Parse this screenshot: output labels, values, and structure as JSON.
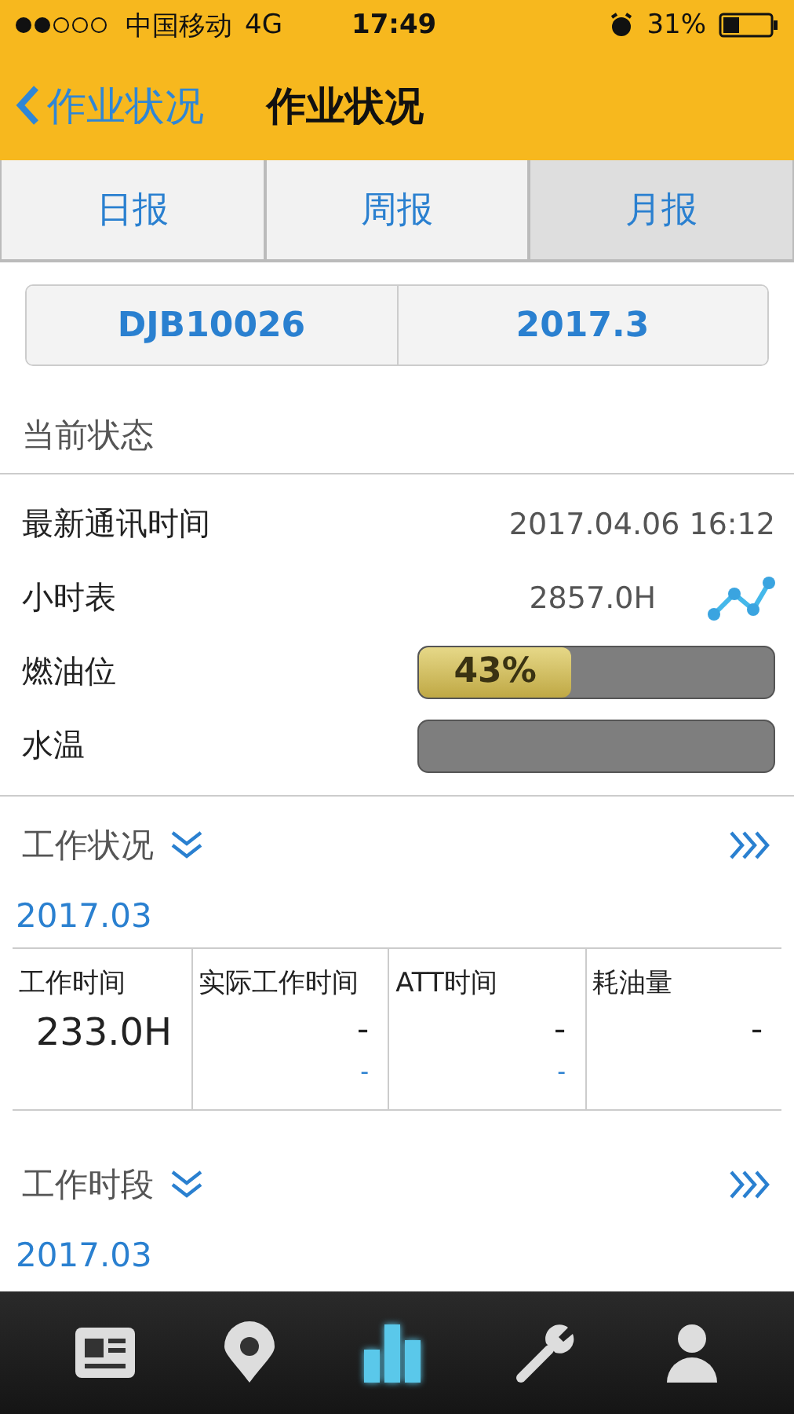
{
  "status_bar": {
    "carrier": "中国移动",
    "network": "4G",
    "time": "17:49",
    "battery": "31%"
  },
  "nav": {
    "back": "作业状况",
    "title": "作业状况"
  },
  "tabs": [
    {
      "label": "日报",
      "selected": false
    },
    {
      "label": "周报",
      "selected": false
    },
    {
      "label": "月报",
      "selected": true
    }
  ],
  "selector": [
    "DJB10026",
    "2017.3"
  ],
  "current_status": {
    "title": "当前状态",
    "rows": [
      {
        "kind": "text",
        "label": "最新通讯时间",
        "value": "2017.04.06 16:12"
      },
      {
        "kind": "chart",
        "label": "小时表",
        "value": "2857.0H"
      },
      {
        "kind": "meter",
        "label": "燃油位",
        "level": 0.43,
        "reading": "43%"
      },
      {
        "kind": "meter",
        "label": "水温",
        "level": 0
      }
    ]
  },
  "work_status": {
    "title": "工作状况",
    "date": "2017.03",
    "columns": [
      {
        "label": "工作时间",
        "value": "233.0H"
      },
      {
        "label": "实际工作时间",
        "value": "-",
        "sub": "-"
      },
      {
        "label": "ATT时间",
        "value": "-",
        "sub": "-"
      },
      {
        "label": "耗油量",
        "value": "-"
      }
    ]
  },
  "work_period": {
    "title": "工作时段",
    "date": "2017.03"
  },
  "tab_bar": [
    {
      "kind": "news",
      "selected": false
    },
    {
      "kind": "location",
      "selected": false
    },
    {
      "kind": "stats",
      "selected": true
    },
    {
      "kind": "tools",
      "selected": false
    },
    {
      "kind": "user",
      "selected": false
    }
  ]
}
